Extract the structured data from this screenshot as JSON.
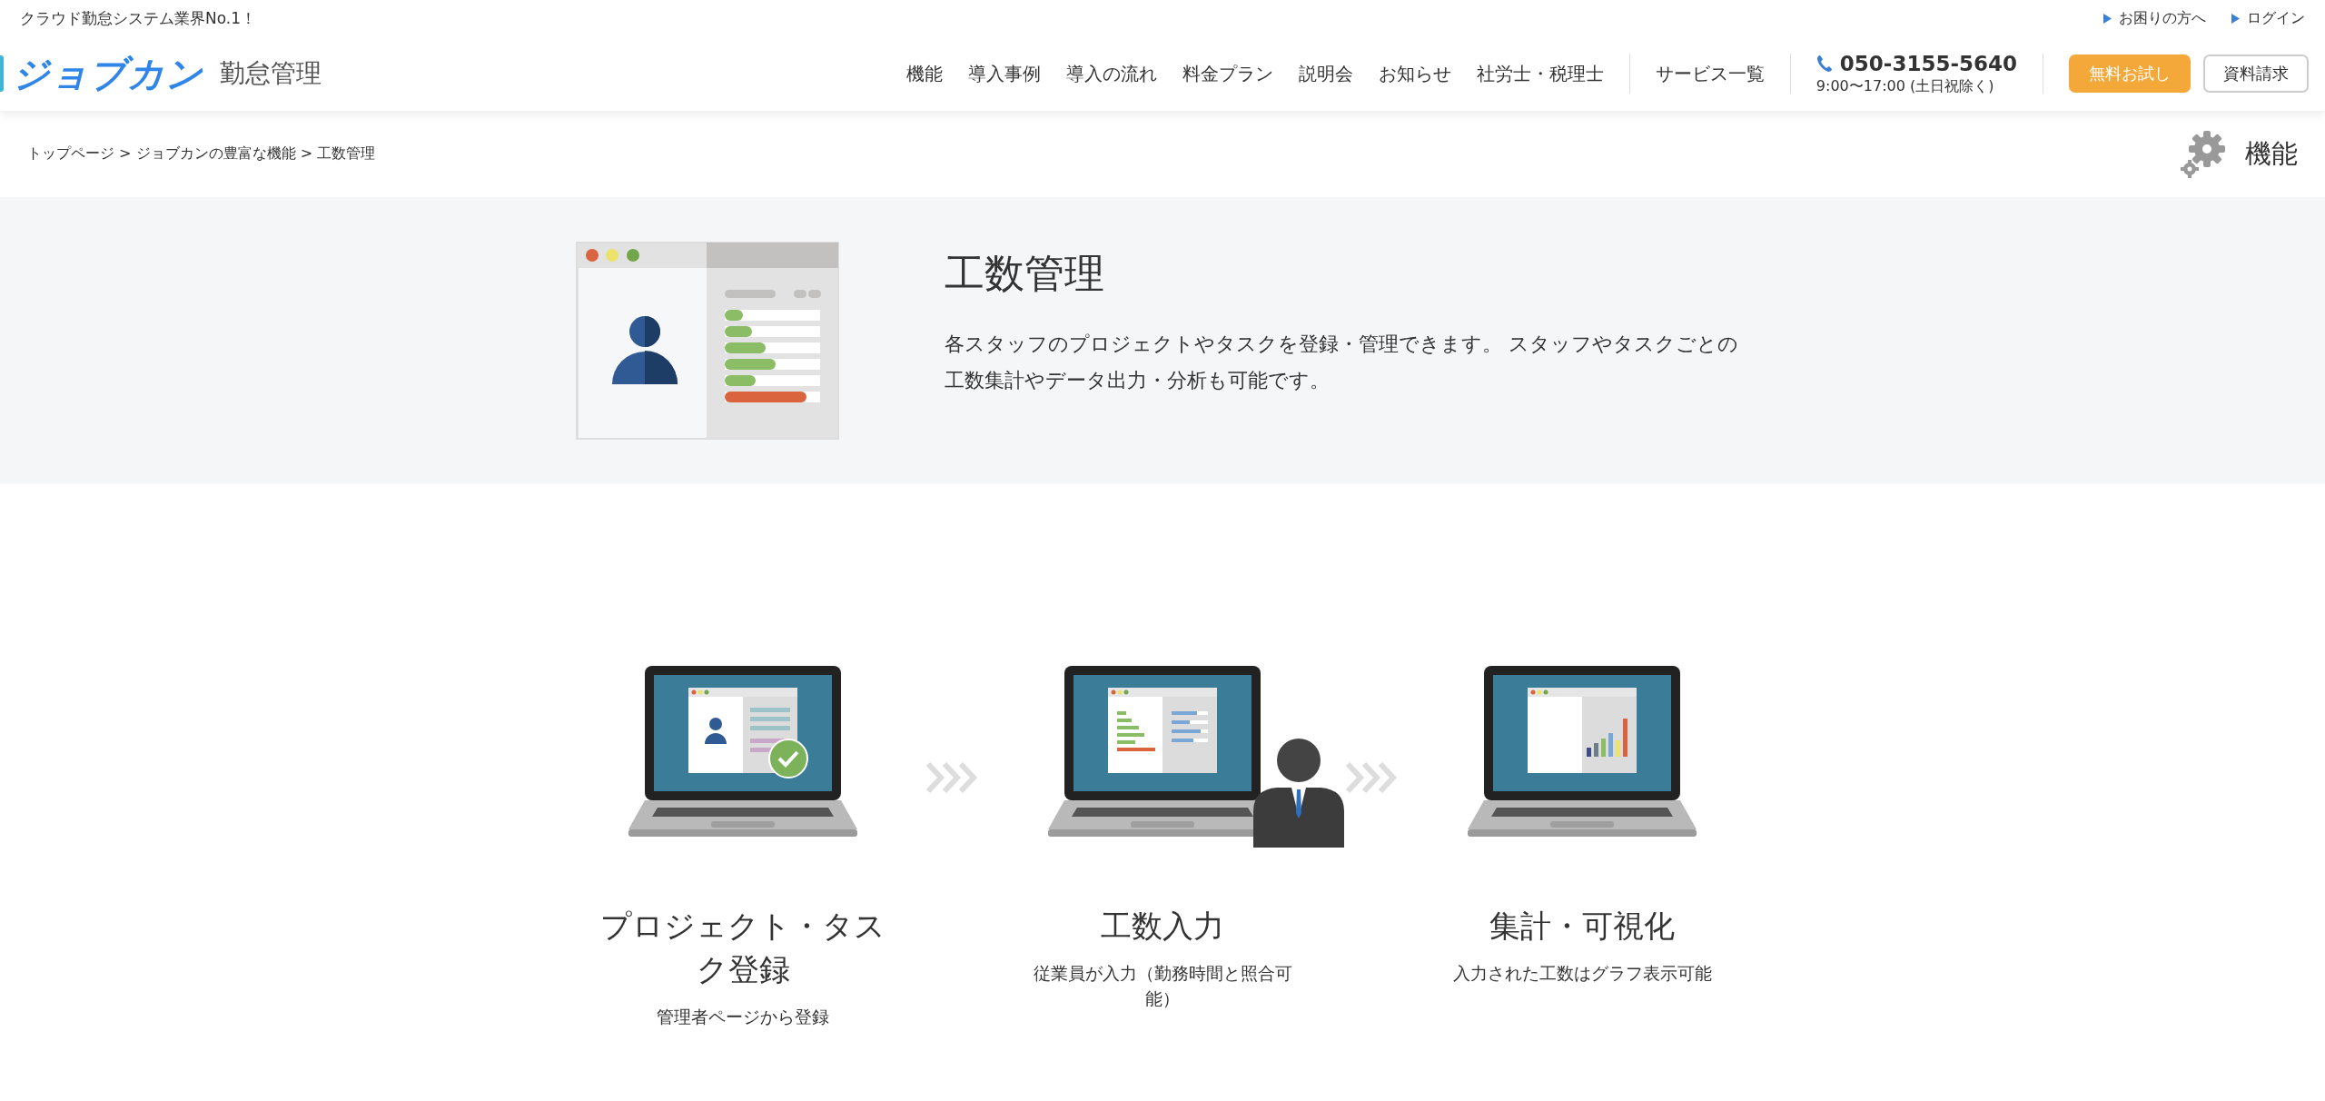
{
  "top_bar": {
    "tagline": "クラウド勤怠システム業界No.1！",
    "links": [
      {
        "label": "お困りの方へ"
      },
      {
        "label": "ログイン"
      }
    ]
  },
  "header": {
    "logo": {
      "brand": "ジョブカン",
      "product": "勤怠管理"
    },
    "nav": [
      "機能",
      "導入事例",
      "導入の流れ",
      "料金プラン",
      "説明会",
      "お知らせ",
      "社労士・税理士"
    ],
    "services_link": "サービス一覧",
    "phone": {
      "number": "050-3155-5640",
      "hours": "9:00〜17:00 (土日祝除く)"
    },
    "buttons": [
      {
        "label": "無料お試し",
        "kind": "primary"
      },
      {
        "label": "資料請求",
        "kind": "outline"
      }
    ]
  },
  "breadcrumb": "トップページ > ジョブカンの豊富な機能 > 工数管理",
  "category": "機能",
  "hero": {
    "title": "工数管理",
    "description": "各スタッフのプロジェクトやタスクを登録・管理できます。 スタッフやタスクごとの工数集計やデータ出力・分析も可能です。"
  },
  "steps": [
    {
      "kind": "register",
      "title": "プロジェクト・タスク登録",
      "text": "管理者ページから登録"
    },
    {
      "kind": "input",
      "title": "工数入力",
      "text": "従業員が入力（勤務時間と照合可能）"
    },
    {
      "kind": "chart",
      "title": "集計・可視化",
      "text": "入力された工数はグラフ表示可能"
    }
  ]
}
